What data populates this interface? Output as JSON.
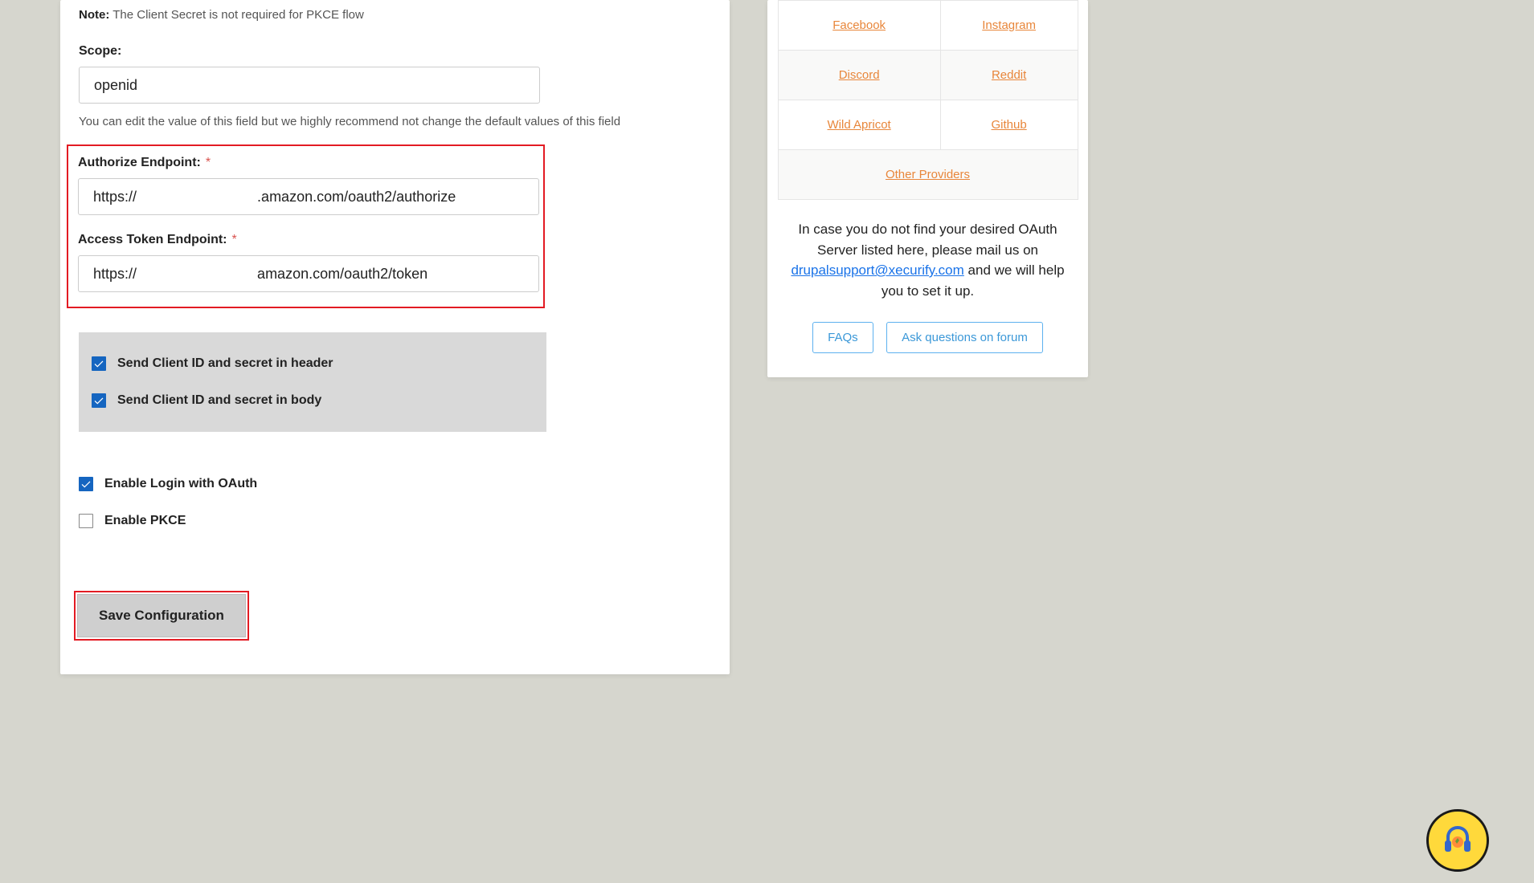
{
  "note": {
    "label": "Note:",
    "text": " The Client Secret is not required for PKCE flow"
  },
  "scope": {
    "label": "Scope:",
    "value": "openid",
    "hint": "You can edit the value of this field but we highly recommend not change the default values of this field"
  },
  "authorize": {
    "label": "Authorize Endpoint:",
    "value": "https://                              .amazon.com/oauth2/authorize"
  },
  "token": {
    "label": "Access Token Endpoint:",
    "value": "https://                             .amazon.com/oauth2/token"
  },
  "checks": {
    "header_label": "Send Client ID and secret in header",
    "body_label": "Send Client ID and secret in body",
    "enable_oauth_label": "Enable Login with OAuth",
    "enable_pkce_label": "Enable PKCE"
  },
  "save_label": "Save Configuration",
  "providers": {
    "r1c1": "Facebook",
    "r1c2": "Instagram",
    "r2c1": "Discord",
    "r2c2": "Reddit",
    "r3c1": "Wild Apricot",
    "r3c2": "Github",
    "other": "Other Providers"
  },
  "sidebar_msg": {
    "part1": "In case you do not find your desired OAuth Server listed here, please mail us on ",
    "email": "drupalsupport@xecurify.com",
    "part2": " and we will help you to set it up."
  },
  "faqs_label": "FAQs",
  "forum_label": "Ask questions on forum"
}
